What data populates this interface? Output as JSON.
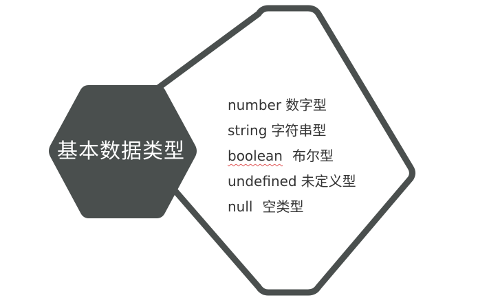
{
  "title": "基本数据类型",
  "colors": {
    "hexagon_fill": "#4a4f4e",
    "outline": "#4a4f4e",
    "text_dark": "#333333",
    "text_light": "#ffffff",
    "spell_underline": "#e05555"
  },
  "types": [
    {
      "name": "number",
      "desc": "数字型"
    },
    {
      "name": "string",
      "desc": "字符串型"
    },
    {
      "name": "boolean",
      "desc": "布尔型"
    },
    {
      "name": "undefined",
      "desc": "未定义型"
    },
    {
      "name": "null",
      "desc": "空类型"
    }
  ]
}
